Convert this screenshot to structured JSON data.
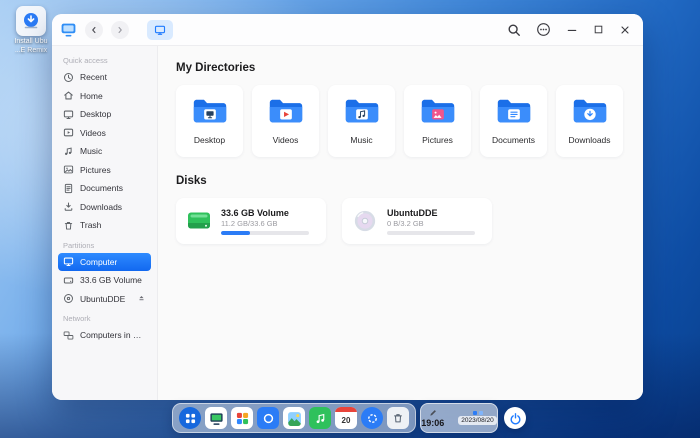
{
  "desktop": {
    "shortcut": {
      "line1": "Install Ubu",
      "line2": "...E Remix"
    }
  },
  "sidebar": {
    "sections": [
      {
        "label": "Quick access",
        "items": [
          {
            "label": "Recent",
            "icon": "clock-icon"
          },
          {
            "label": "Home",
            "icon": "home-icon"
          },
          {
            "label": "Desktop",
            "icon": "monitor-icon"
          },
          {
            "label": "Videos",
            "icon": "video-icon"
          },
          {
            "label": "Music",
            "icon": "music-note-icon"
          },
          {
            "label": "Pictures",
            "icon": "picture-icon"
          },
          {
            "label": "Documents",
            "icon": "document-icon"
          },
          {
            "label": "Downloads",
            "icon": "download-icon"
          },
          {
            "label": "Trash",
            "icon": "trash-icon"
          }
        ]
      },
      {
        "label": "Partitions",
        "items": [
          {
            "label": "Computer",
            "icon": "computer-icon",
            "selected": true
          },
          {
            "label": "33.6 GB Volume",
            "icon": "hard-drive-icon"
          },
          {
            "label": "UbuntuDDE",
            "icon": "disc-icon",
            "eject": true
          }
        ]
      },
      {
        "label": "Network",
        "items": [
          {
            "label": "Computers in LAN",
            "icon": "lan-icon"
          }
        ]
      }
    ]
  },
  "main": {
    "directories_title": "My Directories",
    "directories": [
      {
        "label": "Desktop"
      },
      {
        "label": "Videos"
      },
      {
        "label": "Music"
      },
      {
        "label": "Pictures"
      },
      {
        "label": "Documents"
      },
      {
        "label": "Downloads"
      }
    ],
    "disks_title": "Disks",
    "disks": [
      {
        "name": "33.6 GB Volume",
        "usage": "11.2 GB/33.6 GB",
        "percent": 33
      },
      {
        "name": "UbuntuDDE",
        "usage": "0 B/3.2 GB",
        "percent": 0
      }
    ]
  },
  "dock": {
    "calendar_day": "20"
  },
  "clock": {
    "time": "19:06",
    "date": "2023/08/20"
  },
  "colors": {
    "accent": "#2b7cf6",
    "folder_blue": "#2f87ff",
    "selected_item": "#1268f0",
    "volume_green": "#2fc15c"
  }
}
